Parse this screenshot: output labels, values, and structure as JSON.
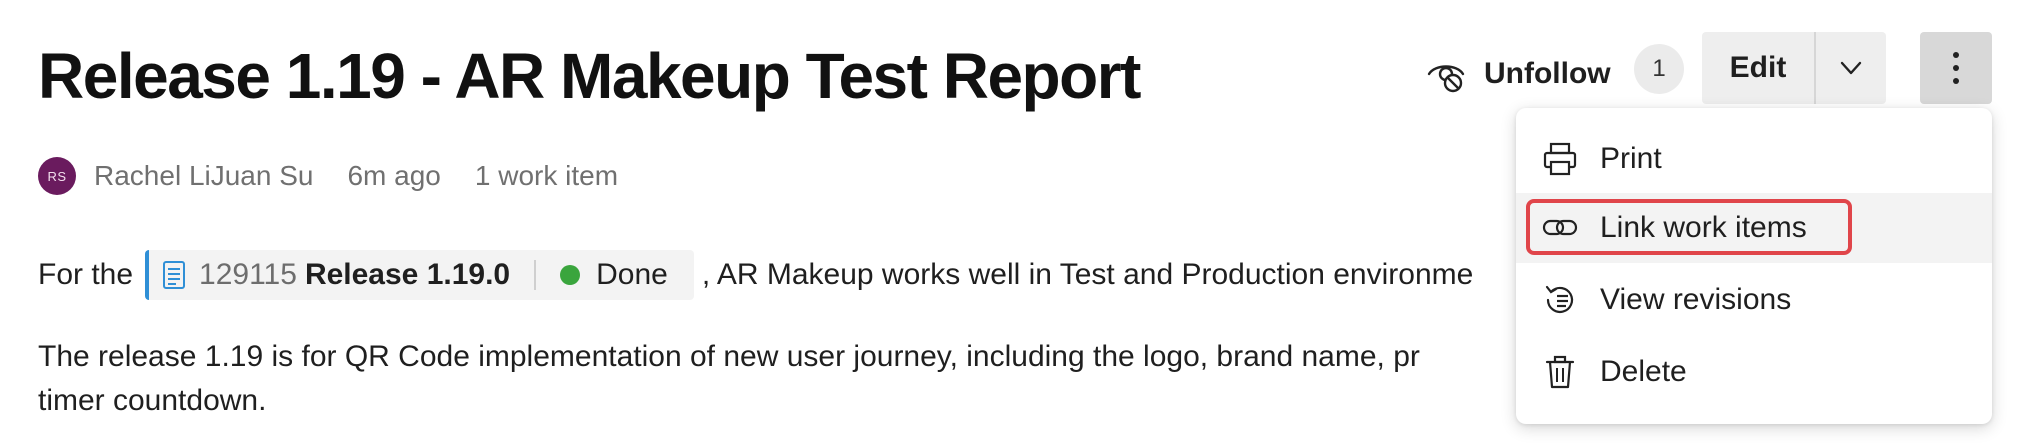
{
  "title": "Release 1.19 - AR Makeup Test Report",
  "meta": {
    "avatar_initials": "RS",
    "author": "Rachel LiJuan Su",
    "time_ago": "6m ago",
    "work_items_count": "1 work item"
  },
  "body": {
    "para1_prefix": "For the",
    "work_item": {
      "id": "129115",
      "name": "Release 1.19.0",
      "state": "Done",
      "state_color": "#3aa53d",
      "icon": "work-item-icon"
    },
    "para1_suffix": ", AR Makeup works well in Test and Production environme",
    "para2_line1": "The release 1.19 is for QR Code implementation of new user journey, including the logo, brand name, pr",
    "para2_line2": "timer countdown."
  },
  "header_actions": {
    "unfollow_label": "Unfollow",
    "follow_count": "1",
    "edit_label": "Edit"
  },
  "menu": {
    "items": [
      {
        "label": "Print",
        "icon": "printer-icon"
      },
      {
        "label": "Link work items",
        "icon": "link-icon",
        "highlighted": true
      },
      {
        "label": "View revisions",
        "icon": "history-icon"
      },
      {
        "label": "Delete",
        "icon": "trash-icon"
      }
    ]
  },
  "colors": {
    "avatar_bg": "#6a1b5e",
    "chip_accent": "#2f8fd6",
    "highlight": "#e0454a"
  }
}
